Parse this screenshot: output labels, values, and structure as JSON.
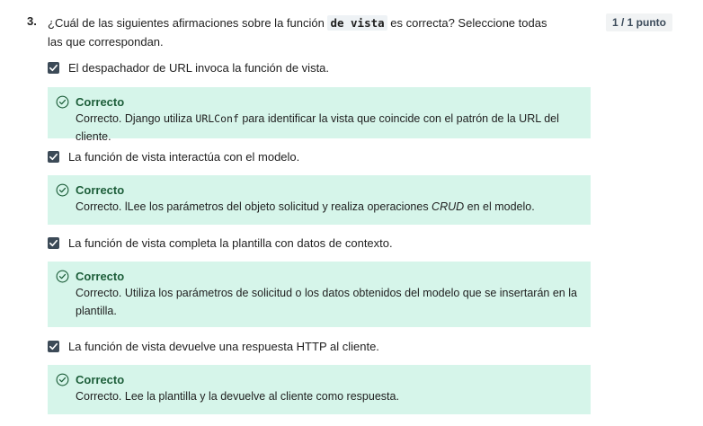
{
  "question": {
    "number": "3.",
    "text_before": "¿Cuál de las siguientes afirmaciones sobre la función ",
    "code": "de vista",
    "text_after": " es correcta? Seleccione todas las que correspondan.",
    "points": "1 / 1 punto"
  },
  "options": [
    {
      "label": "El despachador de URL invoca la función de vista.",
      "checked": true,
      "feedback_title": "Correcto",
      "feedback_before": "Correcto. Django utiliza ",
      "feedback_code": "URLConf",
      "feedback_after": " para identificar la vista que coincide con el patrón de la URL del cliente."
    },
    {
      "label": "La función de vista interactúa con el modelo.",
      "checked": true,
      "feedback_title": "Correcto",
      "feedback_before": "Correcto. lLee los parámetros del objeto solicitud y realiza operaciones ",
      "feedback_em": "CRUD",
      "feedback_after": " en el modelo."
    },
    {
      "label": "La función de vista completa la plantilla con datos de contexto.",
      "checked": true,
      "feedback_title": "Correcto",
      "feedback_text": "Correcto. Utiliza los parámetros de solicitud o los datos obtenidos del modelo que se insertarán en la plantilla."
    },
    {
      "label": "La función de vista devuelve una respuesta HTTP al cliente.",
      "checked": true,
      "feedback_title": "Correcto",
      "feedback_text": "Correcto. Lee la plantilla y la devuelve al cliente como respuesta."
    }
  ],
  "colors": {
    "feedback_bg": "#d6f5ea",
    "correct_text": "#1d5e3a",
    "checkbox": "#3c4a57"
  }
}
